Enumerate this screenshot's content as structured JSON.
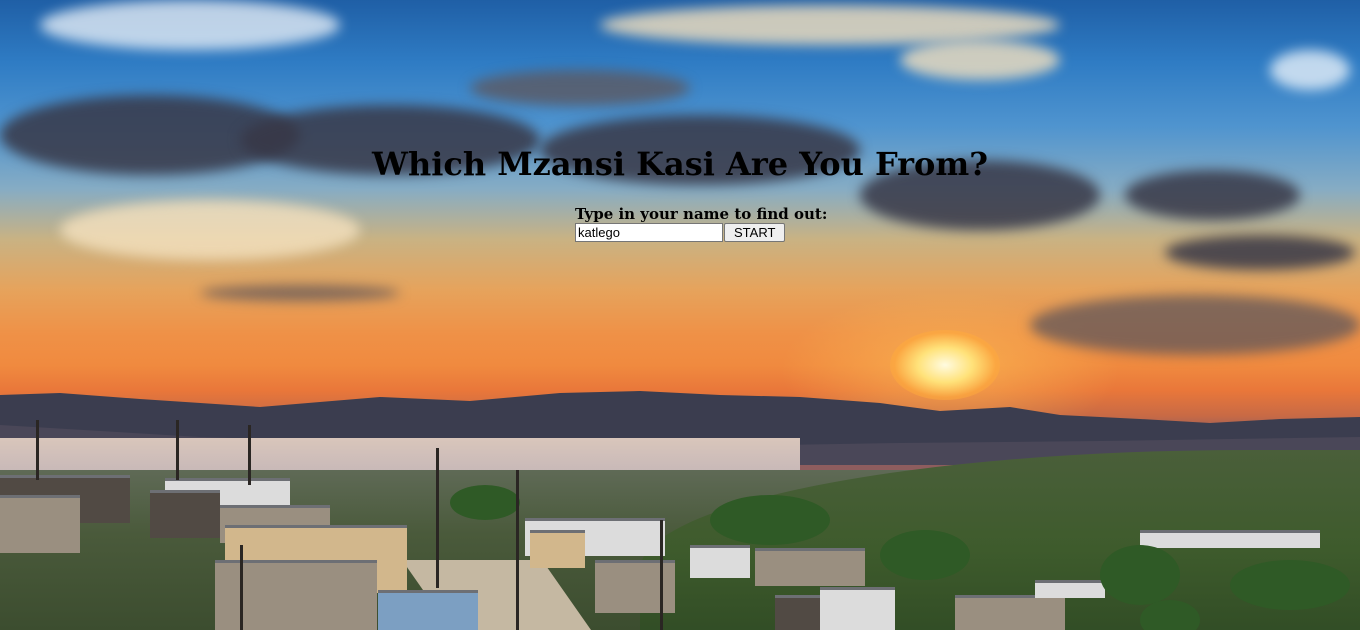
{
  "page": {
    "title": "Which Mzansi Kasi Are You From?"
  },
  "form": {
    "prompt": "Type in your name to find out:",
    "name_value": "katlego",
    "start_label": "START"
  },
  "background": {
    "description_icon": "sunset-township-photo",
    "accent_colors": {
      "sky_top": "#1f5fa6",
      "sunset_orange": "#f08a3f",
      "sun": "#ffe27a"
    }
  }
}
